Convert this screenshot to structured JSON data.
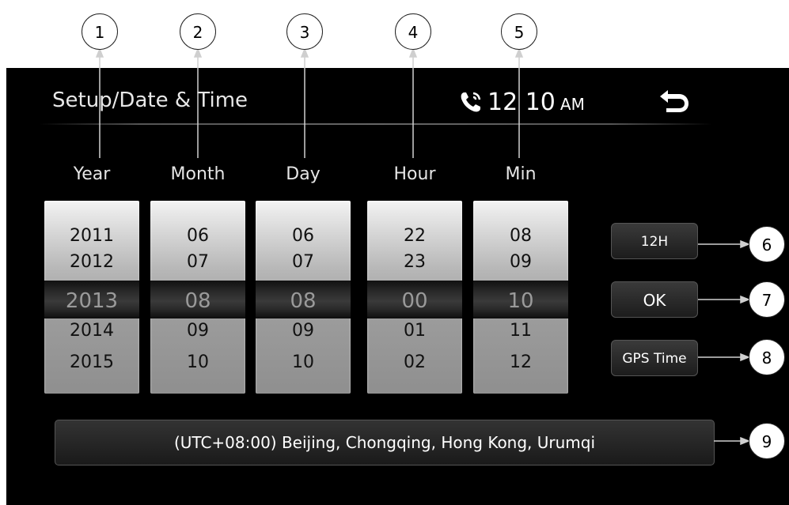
{
  "header": {
    "title": "Setup/Date & Time",
    "clock_hhmm": "12 10",
    "clock_ampm": "AM"
  },
  "columns": [
    {
      "label": "Year",
      "values": [
        "2011",
        "2012",
        "2013",
        "2014",
        "2015"
      ]
    },
    {
      "label": "Month",
      "values": [
        "06",
        "07",
        "08",
        "09",
        "10"
      ]
    },
    {
      "label": "Day",
      "values": [
        "06",
        "07",
        "08",
        "09",
        "10"
      ]
    },
    {
      "label": "Hour",
      "values": [
        "22",
        "23",
        "00",
        "01",
        "02"
      ]
    },
    {
      "label": "Min",
      "values": [
        "08",
        "09",
        "10",
        "11",
        "12"
      ]
    }
  ],
  "buttons": {
    "format": "12H",
    "ok": "OK",
    "gps": "GPS Time"
  },
  "timezone": "(UTC+08:00) Beijing, Chongqing, Hong Kong, Urumqi",
  "callouts": [
    "1",
    "2",
    "3",
    "4",
    "5",
    "6",
    "7",
    "8",
    "9"
  ],
  "icons": {
    "phone": "phone-icon",
    "back": "back-arrow-icon"
  }
}
